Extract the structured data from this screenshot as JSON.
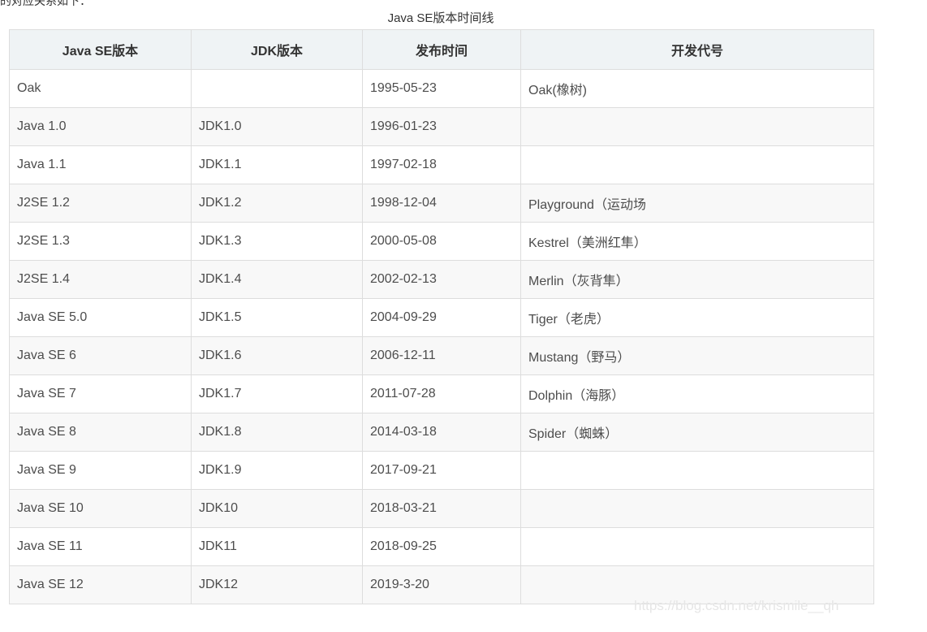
{
  "top_fragment": "的对应关系如下：",
  "caption": "Java SE版本时间线",
  "table": {
    "headers": [
      "Java SE版本",
      "JDK版本",
      "发布时间",
      "开发代号"
    ],
    "rows": [
      [
        "Oak",
        "",
        "1995-05-23",
        "Oak(橡树)"
      ],
      [
        "Java 1.0",
        "JDK1.0",
        "1996-01-23",
        ""
      ],
      [
        "Java 1.1",
        "JDK1.1",
        "1997-02-18",
        ""
      ],
      [
        "J2SE 1.2",
        "JDK1.2",
        "1998-12-04",
        "Playground（运动场"
      ],
      [
        "J2SE 1.3",
        "JDK1.3",
        "2000-05-08",
        "Kestrel（美洲红隼）"
      ],
      [
        "J2SE 1.4",
        "JDK1.4",
        "2002-02-13",
        "Merlin（灰背隼）"
      ],
      [
        "Java SE 5.0",
        "JDK1.5",
        "2004-09-29",
        "Tiger（老虎）"
      ],
      [
        "Java SE 6",
        "JDK1.6",
        "2006-12-11",
        "Mustang（野马）"
      ],
      [
        "Java SE 7",
        "JDK1.7",
        "2011-07-28",
        "Dolphin（海豚）"
      ],
      [
        "Java SE 8",
        "JDK1.8",
        "2014-03-18",
        "Spider（蜘蛛）"
      ],
      [
        "Java SE 9",
        "JDK1.9",
        "2017-09-21",
        ""
      ],
      [
        "Java SE 10",
        "JDK10",
        "2018-03-21",
        ""
      ],
      [
        "Java SE 11",
        "JDK11",
        "2018-09-25",
        ""
      ],
      [
        "Java SE 12",
        "JDK12",
        "2019-3-20",
        ""
      ]
    ]
  },
  "watermark": "https://blog.csdn.net/krismile__qh"
}
